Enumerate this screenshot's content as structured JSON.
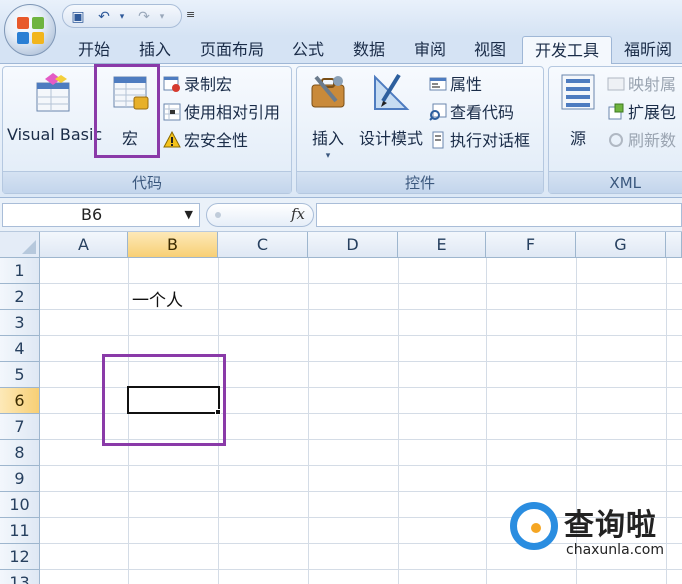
{
  "tabs": [
    "开始",
    "插入",
    "页面布局",
    "公式",
    "数据",
    "审阅",
    "视图",
    "开发工具",
    "福昕阅读"
  ],
  "active_tab": "开发工具",
  "ribbon": {
    "code_group": {
      "label": "代码",
      "visual_basic": "Visual Basic",
      "macros": "宏",
      "record_macro": "录制宏",
      "use_relative_refs": "使用相对引用",
      "macro_security": "宏安全性"
    },
    "controls_group": {
      "label": "控件",
      "insert": "插入",
      "design_mode": "设计模式",
      "properties": "属性",
      "view_code": "查看代码",
      "run_dialog": "执行对话框"
    },
    "xml_group": {
      "label": "XML",
      "source": "源",
      "map_properties": "映射属",
      "expansion_packs": "扩展包",
      "refresh_data": "刷新数"
    }
  },
  "formula_bar": {
    "name_box": "B6",
    "fx_label": "fx",
    "formula": ""
  },
  "grid": {
    "columns": [
      "A",
      "B",
      "C",
      "D",
      "E",
      "F",
      "G"
    ],
    "active_column": "B",
    "rows": [
      "1",
      "2",
      "3",
      "4",
      "5",
      "6",
      "7",
      "8",
      "9",
      "10",
      "11",
      "12",
      "13"
    ],
    "active_row": "6",
    "cells": {
      "B2": "一个人"
    }
  },
  "watermark": {
    "brand": "查询啦",
    "domain": "chaxunla.com"
  },
  "colors": {
    "highlight": "#8a3aa8",
    "ribbon_bg": "#dce8f6",
    "active_header": "#f7cf75"
  }
}
